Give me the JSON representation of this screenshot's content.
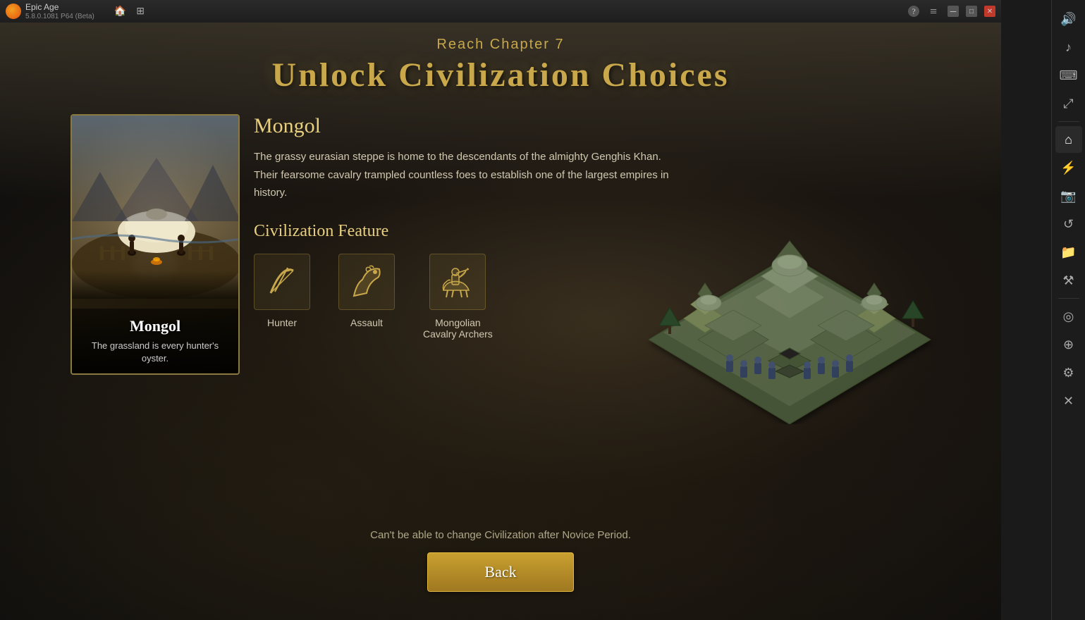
{
  "titlebar": {
    "app_name": "Epic Age",
    "app_version": "5.8.0.1081 P64 (Beta)",
    "home_icon": "🏠",
    "grid_icon": "⊞"
  },
  "header": {
    "chapter_text": "Reach Chapter 7",
    "main_title": "Unlock Civilization Choices"
  },
  "civ_card": {
    "name": "Mongol",
    "tagline": "The grassland is every hunter's oyster."
  },
  "civ_info": {
    "title": "Mongol",
    "description": "The grassy eurasian steppe is home to the descendants of the almighty Genghis Khan. Their fearsome cavalry trampled countless foes to establish one of the largest empires in history.",
    "feature_label": "Civilization Feature",
    "features": [
      {
        "icon": "🏹",
        "label": "Hunter"
      },
      {
        "icon": "🐴",
        "label": "Assault"
      },
      {
        "icon": "🏇",
        "label": "Mongolian\nCavalry Archers"
      }
    ]
  },
  "footer": {
    "warning": "Can't be able to change Civilization after Novice Period.",
    "back_button": "Back"
  },
  "sidebar": {
    "buttons": [
      {
        "icon": "⊕",
        "label": "volume"
      },
      {
        "icon": "🎵",
        "label": "music"
      },
      {
        "icon": "⌨",
        "label": "keyboard"
      },
      {
        "icon": "↕",
        "label": "rotate"
      },
      {
        "icon": "🏠",
        "label": "home"
      },
      {
        "icon": "⚡",
        "label": "performance"
      },
      {
        "icon": "📷",
        "label": "screenshot"
      },
      {
        "icon": "⟳",
        "label": "refresh"
      },
      {
        "icon": "📁",
        "label": "files"
      },
      {
        "icon": "🔧",
        "label": "tools"
      },
      {
        "icon": "◎",
        "label": "target"
      },
      {
        "icon": "🌐",
        "label": "network"
      },
      {
        "icon": "⚙",
        "label": "settings"
      },
      {
        "icon": "⊗",
        "label": "close-extra"
      }
    ]
  }
}
